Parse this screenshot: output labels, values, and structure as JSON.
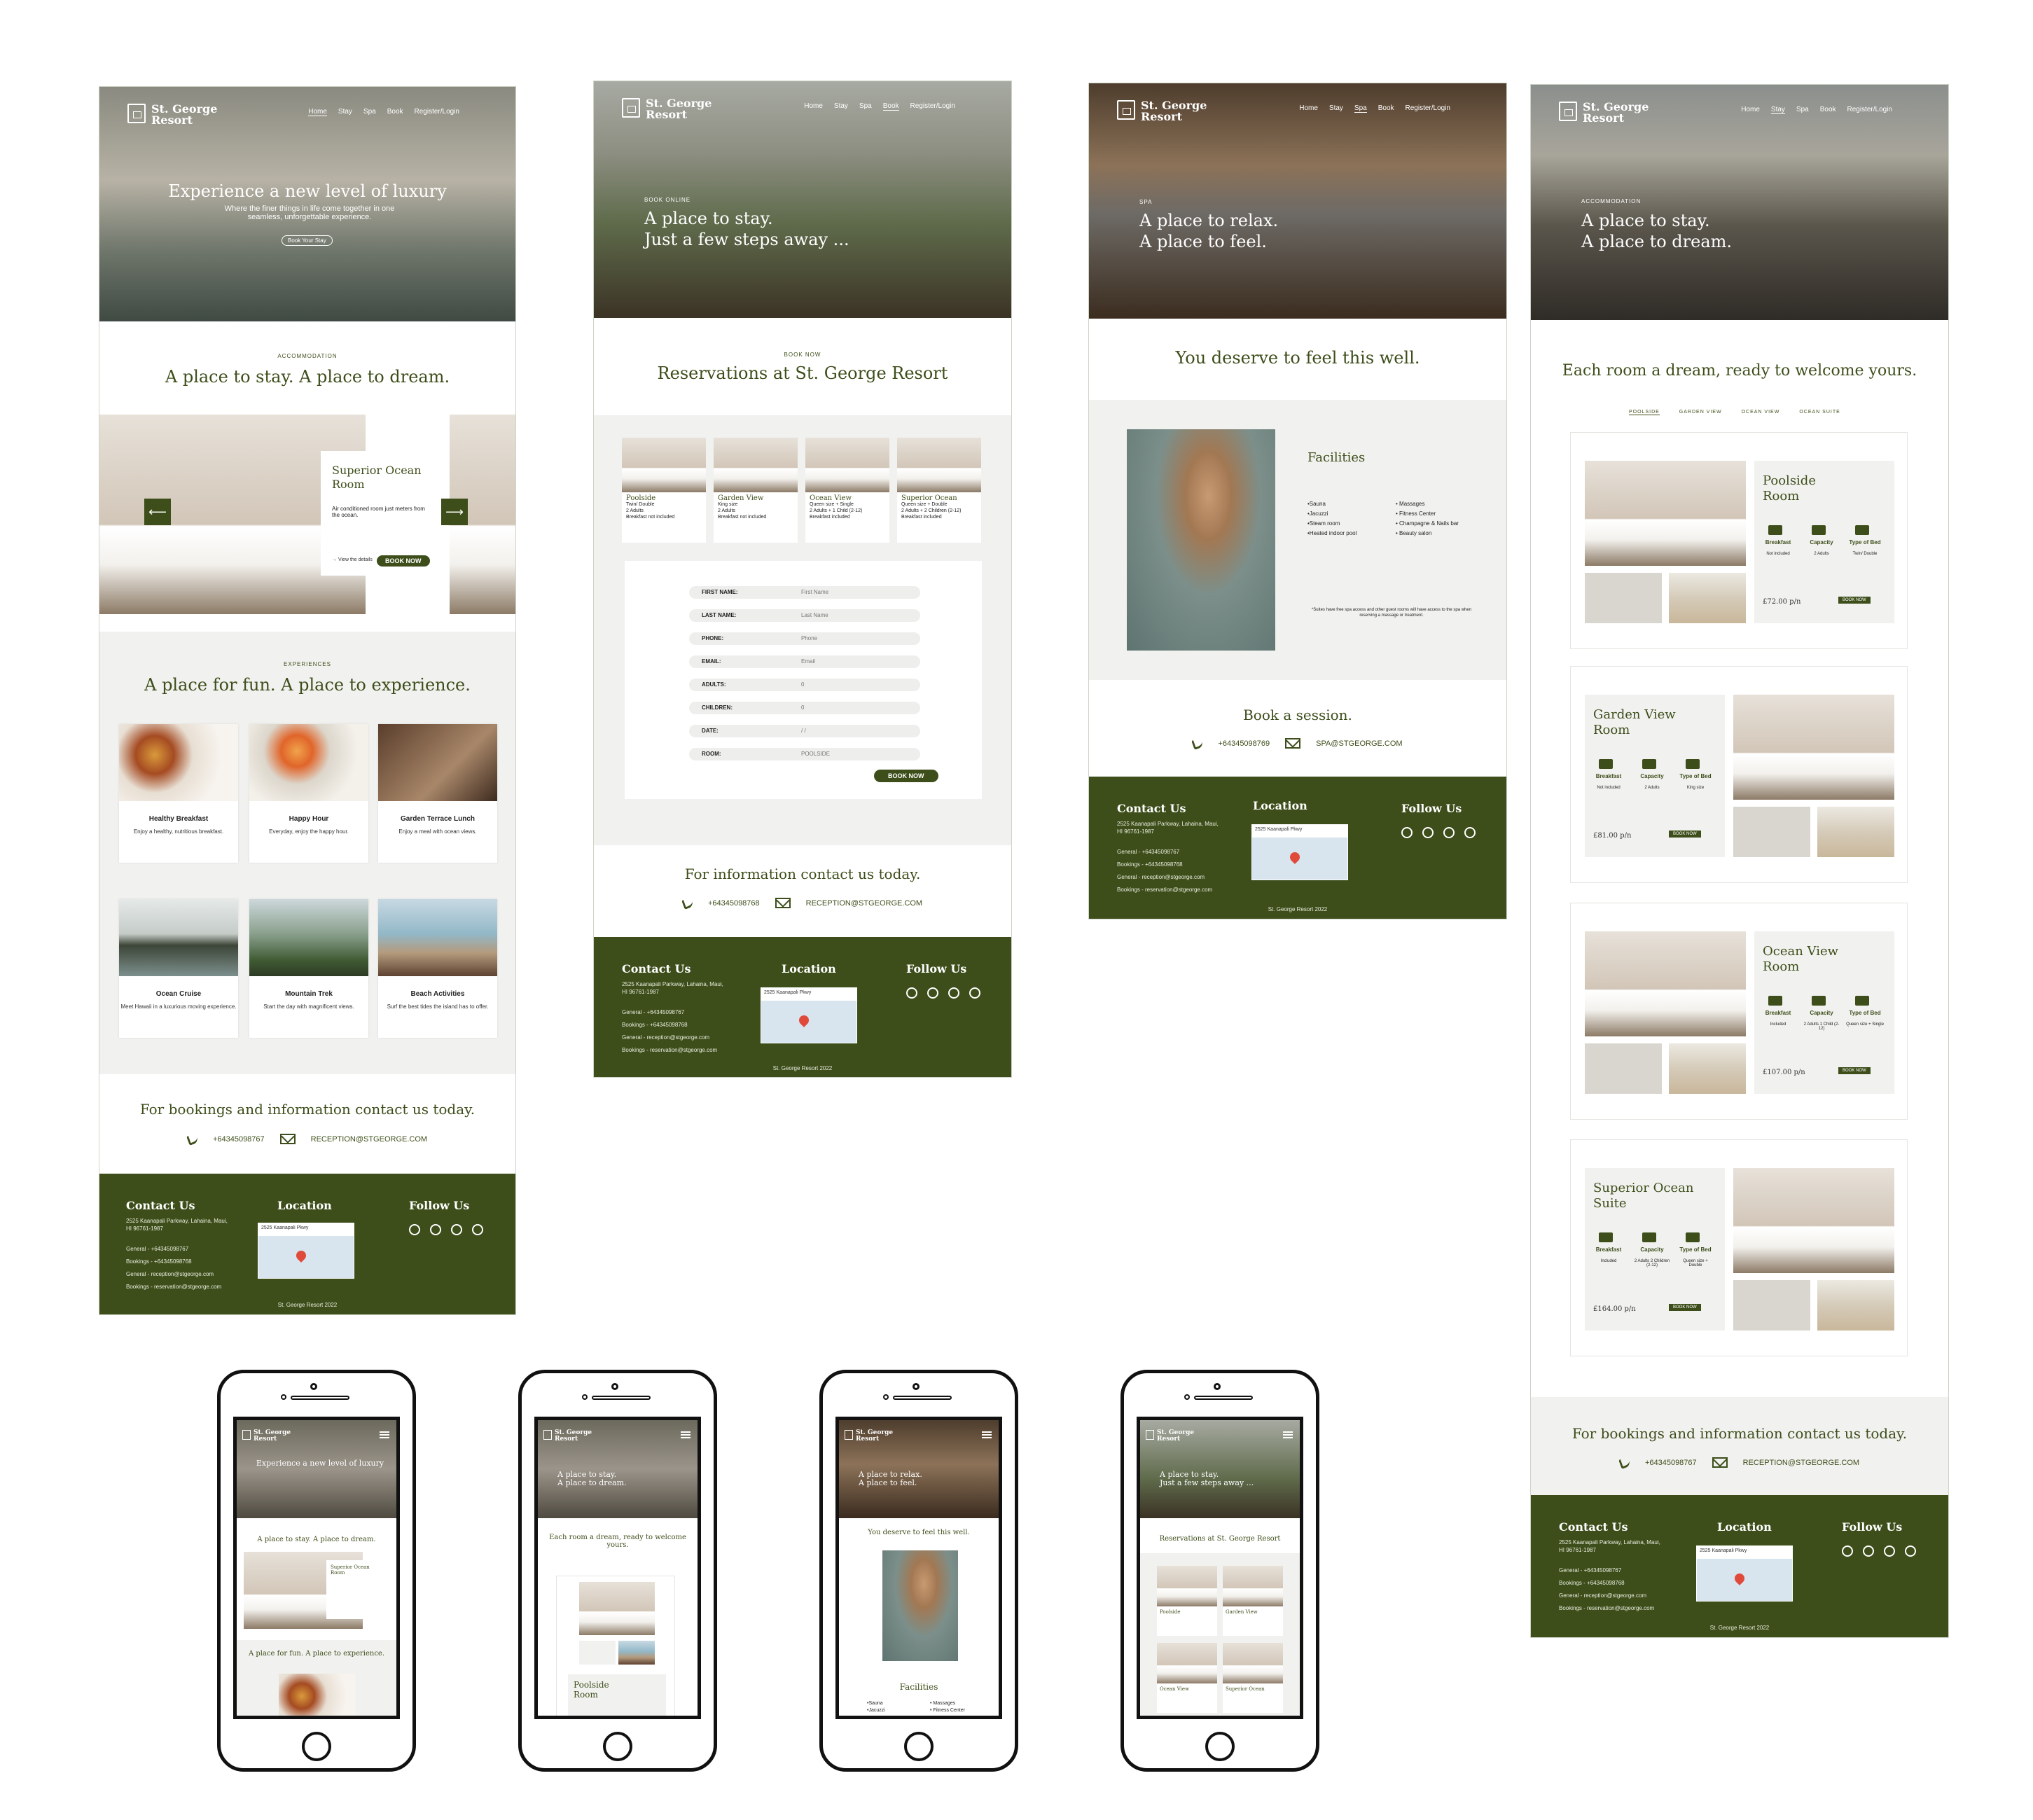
{
  "brand": {
    "name": "St. George Resort",
    "line1": "St. George",
    "line2": "Resort",
    "accent": "#3d4e1a"
  },
  "nav": {
    "home": "Home",
    "stay": "Stay",
    "spa": "Spa",
    "book": "Book",
    "register": "Register/Login"
  },
  "home": {
    "hero_title": "Experience a new level of luxury",
    "hero_sub": "Where the finer things in life come together in one seamless, unforgettable experience.",
    "hero_cta": "Book Your Stay",
    "acc_eyebrow": "ACCOMMODATION",
    "acc_title": "A place to stay. A place to dream.",
    "room_title": "Superior Ocean Room",
    "room_desc": "Air conditioned room just meters from the ocean.",
    "room_link": "View the details",
    "room_btn": "BOOK NOW",
    "exp_eyebrow": "EXPERIENCES",
    "exp_title": "A place for fun. A place to experience.",
    "experiences": [
      {
        "title": "Healthy Breakfast",
        "desc": "Enjoy a healthy, nutritious breakfast."
      },
      {
        "title": "Happy Hour",
        "desc": "Everyday, enjoy the happy hour."
      },
      {
        "title": "Garden Terrace Lunch",
        "desc": "Enjoy a meal with ocean views."
      },
      {
        "title": "Ocean Cruise",
        "desc": "Meet Hawaii in a luxurious moving experience."
      },
      {
        "title": "Mountain Trek",
        "desc": "Start the day with magnificent views."
      },
      {
        "title": "Beach Activities",
        "desc": "Surf the best tides the island has to offer."
      }
    ],
    "contact_title": "For bookings and information contact us today.",
    "phone": "+64345098767",
    "email": "RECEPTION@STGEORGE.COM"
  },
  "footer": {
    "contact_head": "Contact Us",
    "address": "2525 Kaanapali Parkway, Lahaina, Maui, HI 96761-1987",
    "general": "General - +64345098767",
    "bookings": "Bookings - +64345098768",
    "general_mail": "General - reception@stgeorge.com",
    "bookings_mail": "Bookings - reservation@stgeorge.com",
    "location_head": "Location",
    "map_label": "2525 Kaanapali Pkwy",
    "follow_head": "Follow Us",
    "copyright": "St. George Resort 2022"
  },
  "book": {
    "eyebrow": "BOOK ONLINE",
    "hero_line1": "A place to stay.",
    "hero_line2": "Just a few steps away ...",
    "sec_eyebrow": "BOOK NOW",
    "title": "Reservations at St. George Resort",
    "rooms": [
      {
        "name": "Poolside",
        "l1": "Twin/ Double",
        "l2": "2 Adults",
        "l3": "Breakfast not included"
      },
      {
        "name": "Garden View",
        "l1": "King size",
        "l2": "2 Adults",
        "l3": "Breakfast not included"
      },
      {
        "name": "Ocean View",
        "l1": "Queen size + Single",
        "l2": "2 Adults + 1 Child (2-12)",
        "l3": "Breakfast included"
      },
      {
        "name": "Superior Ocean",
        "l1": "Queen size + Double",
        "l2": "2 Adults + 2 Children (2-12)",
        "l3": "Breakfast included"
      }
    ],
    "form": [
      {
        "label": "FIRST NAME:",
        "value": "First Name"
      },
      {
        "label": "LAST NAME:",
        "value": "Last Name"
      },
      {
        "label": "PHONE:",
        "value": "Phone"
      },
      {
        "label": "EMAIL:",
        "value": "Email"
      },
      {
        "label": "ADULTS:",
        "value": "0"
      },
      {
        "label": "CHILDREN:",
        "value": "0"
      },
      {
        "label": "DATE:",
        "value": "/ /"
      },
      {
        "label": "ROOM:",
        "value": "POOLSIDE"
      }
    ],
    "btn": "BOOK NOW",
    "contact_title": "For information contact us today.",
    "phone": "+64345098768",
    "email": "RECEPTION@STGEORGE.COM"
  },
  "spa": {
    "eyebrow": "SPA",
    "hero_line1": "A place to relax.",
    "hero_line2": "A place to feel.",
    "title": "You deserve to feel this well.",
    "facilities_head": "Facilities",
    "col1": [
      "•Sauna",
      "•Jacuzzi",
      "•Steam room",
      "•Heated indoor pool"
    ],
    "col2": [
      "• Massages",
      "• Fitness Center",
      "• Champagne & Nails bar",
      "• Beauty salon"
    ],
    "note": "*Suites have free spa access and other guest rooms will have access to the spa when reserving a massage or treatment.",
    "book_title": "Book a session.",
    "phone": "+64345098769",
    "email": "SPA@STGEORGE.COM"
  },
  "stay": {
    "eyebrow": "ACCOMMODATION",
    "hero_line1": "A place to stay.",
    "hero_line2": "A place to dream.",
    "title": "Each room a dream, ready to welcome yours.",
    "tabs": [
      "POOLSIDE",
      "GARDEN VIEW",
      "OCEAN VIEW",
      "OCEAN SUITE"
    ],
    "amen": [
      "Breakfast",
      "Capacity",
      "Type of Bed"
    ],
    "rooms": [
      {
        "name1": "Poolside",
        "name2": "Room",
        "b": "Not included",
        "c": "2 Adults",
        "t": "Twin/ Double",
        "price": "£72.00 p/n"
      },
      {
        "name1": "Garden View",
        "name2": "Room",
        "b": "Not included",
        "c": "2 Adults",
        "t": "King size",
        "price": "£81.00 p/n"
      },
      {
        "name1": "Ocean View",
        "name2": "Room",
        "b": "Included",
        "c": "2 Adults 1 Child (2-12)",
        "t": "Queen size + Single",
        "price": "£107.00 p/n"
      },
      {
        "name1": "Superior Ocean",
        "name2": "Suite",
        "b": "Included",
        "c": "2 Adults 2 Children (2-12)",
        "t": "Queen size + Double",
        "price": "£164.00 p/n"
      }
    ],
    "btn": "BOOK NOW",
    "contact_title": "For bookings and information contact us today.",
    "phone": "+64345098767",
    "email": "RECEPTION@STGEORGE.COM"
  },
  "mobile": {
    "m1_hero": "Experience a new level of luxury",
    "m1_title": "A place to stay. A place to dream.",
    "m1_room": "Superior Ocean Room",
    "m1_exp": "A place for fun. A place to experience.",
    "m2_hero1": "A place to stay.",
    "m2_hero2": "A place to dream.",
    "m2_title": "Each room a dream, ready to welcome yours.",
    "m2_room1": "Poolside",
    "m2_room2": "Room",
    "m3_hero1": "A place to relax.",
    "m3_hero2": "A place to feel.",
    "m3_title": "You deserve to feel this well.",
    "m3_fac": "Facilities",
    "m3_l1": "•Sauna",
    "m3_l2": "•Jacuzzi",
    "m3_r1": "• Massages",
    "m3_r2": "• Fitness Center",
    "m4_hero1": "A place to stay.",
    "m4_hero2": "Just a few steps away ...",
    "m4_title": "Reservations at St. George Resort",
    "m4_r1": "Poolside",
    "m4_r2": "Garden View",
    "m4_r3": "Ocean View",
    "m4_r4": "Superior Ocean"
  }
}
